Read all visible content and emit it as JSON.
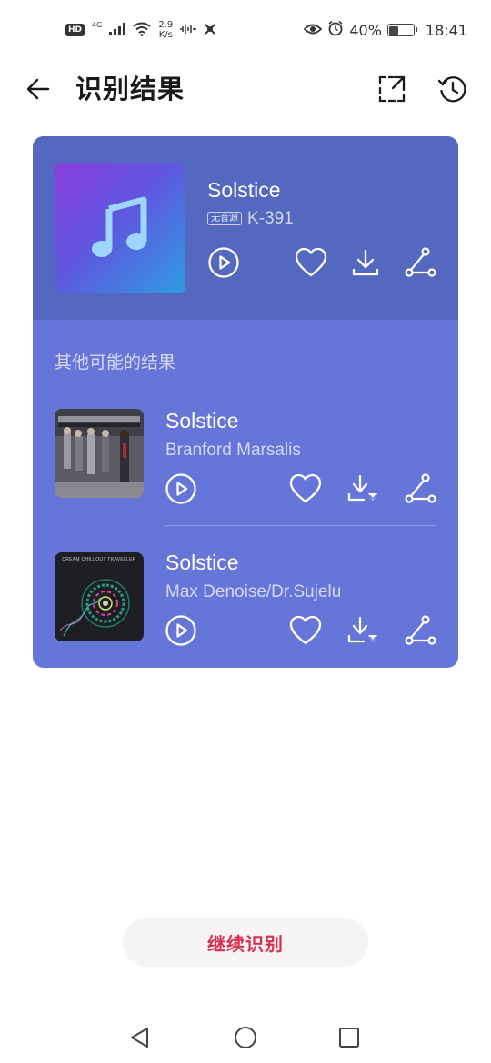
{
  "status_bar": {
    "hd": "HD",
    "network": "4G",
    "speed_value": "2.9",
    "speed_unit": "K/s",
    "battery": "40%",
    "battery_level": 0.4,
    "time": "18:41",
    "icons": [
      "signal-icon",
      "wifi-icon",
      "audio-wave-icon",
      "notification-icon",
      "eye-icon",
      "alarm-icon",
      "battery-icon"
    ]
  },
  "header": {
    "title": "识别结果",
    "icons": [
      "back-arrow-icon",
      "fullscreen-expand-icon",
      "history-clock-icon"
    ]
  },
  "top_result": {
    "title": "Solstice",
    "tag": "无音源",
    "subtitle": "K-391",
    "cover_icon": "music-note-icon"
  },
  "other_results": {
    "label": "其他可能的结果",
    "items": [
      {
        "title": "Solstice",
        "artist": "Branford Marsalis"
      },
      {
        "title": "Solstice",
        "artist": "Max Denoise/Dr.Sujelu",
        "cover_text": "DREAM CHILLOUT TRAVELLER"
      }
    ]
  },
  "actions": [
    "play-icon",
    "heart-icon",
    "download-icon",
    "share-icon"
  ],
  "continue_button": "继续识别",
  "colors": {
    "card_top": "#5468bf",
    "card_bottom": "#6575d8",
    "accent": "#d8304f"
  }
}
